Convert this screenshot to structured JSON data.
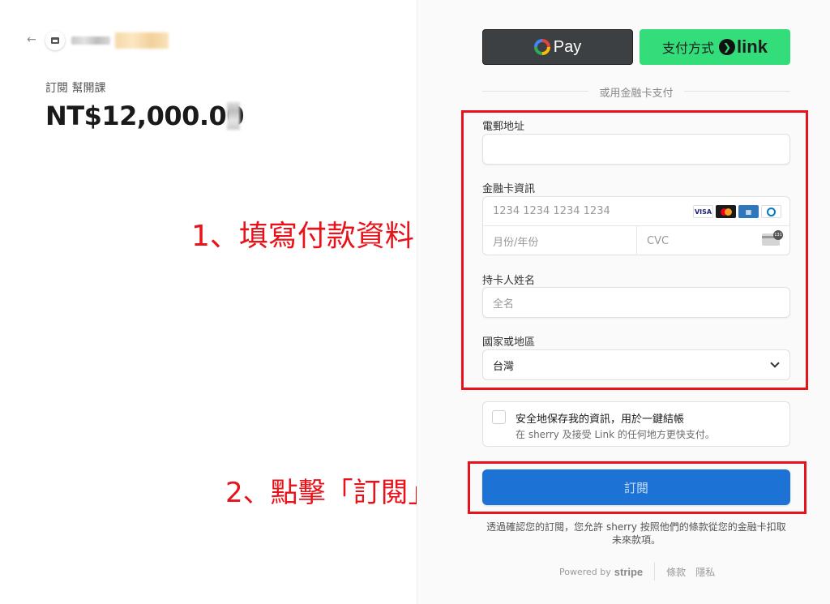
{
  "left": {
    "product_name": "訂閱 幫開課",
    "price": "NT$12,000.00"
  },
  "annotations": {
    "step1": "1、填寫付款資料",
    "step2": "2、點擊「訂閱」"
  },
  "express": {
    "gpay_label": "Pay",
    "link_label": "支付方式",
    "link_word": "link",
    "divider_text": "或用金融卡支付"
  },
  "form": {
    "email_label": "電郵地址",
    "email_value": "",
    "card_label": "金融卡資訊",
    "card_number_placeholder": "1234 1234 1234 1234",
    "expiry_placeholder": "月份/年份",
    "cvc_placeholder": "CVC",
    "card_brands": [
      "VISA",
      "mastercard",
      "amex",
      "diners"
    ],
    "name_label": "持卡人姓名",
    "name_placeholder": "全名",
    "country_label": "國家或地區",
    "country_value": "台灣"
  },
  "save": {
    "title": "安全地保存我的資訊，用於一鍵結帳",
    "subtitle": "在 sherry 及接受 Link 的任何地方更快支付。"
  },
  "subscribe": {
    "label": "訂閱",
    "terms": "透過確認您的訂閱，您允許 sherry 按照他們的條款從您的金融卡扣取未來款項。"
  },
  "footer": {
    "powered_by": "Powered by",
    "brand": "stripe",
    "terms_link": "條款",
    "privacy_link": "隱私"
  },
  "colors": {
    "accent_blue": "#1d72d5",
    "link_green": "#33dd7a",
    "annotation_red": "#e8131a"
  }
}
